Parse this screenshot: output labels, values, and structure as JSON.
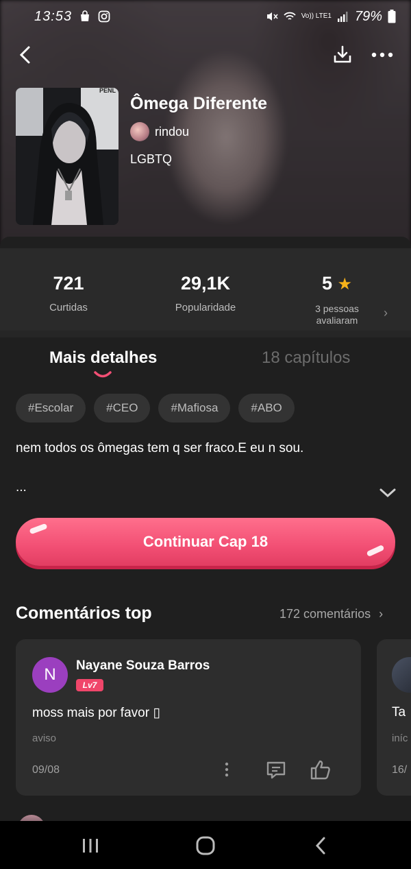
{
  "status_bar": {
    "time": "13:53",
    "battery": "79%",
    "network": "Vo)) LTE1"
  },
  "book": {
    "title": "Ômega Diferente",
    "author": "rindou",
    "genre": "LGBTQ",
    "cover_text": "PENL"
  },
  "stats": {
    "likes_value": "721",
    "likes_label": "Curtidas",
    "popularity_value": "29,1K",
    "popularity_label": "Popularidade",
    "rating_value": "5",
    "rating_label_line1": "3 pessoas",
    "rating_label_line2": "avaliaram"
  },
  "tabs": {
    "details": "Mais detalhes",
    "chapters": "18 capítulos"
  },
  "tags": [
    "#Escolar",
    "#CEO",
    "#Mafiosa",
    "#ABO"
  ],
  "description": "nem todos os ômegas tem q ser fraco.E eu n sou.",
  "ellipsis": "...",
  "continue_button": "Continuar Cap 18",
  "comments": {
    "section_title": "Comentários top",
    "count_label": "172 comentários",
    "items": [
      {
        "avatar_letter": "N",
        "name": "Nayane Souza Barros",
        "level": "Lv7",
        "text": "moss mais por favor ▯",
        "tag": "aviso",
        "date": "09/08"
      },
      {
        "text": "Ta",
        "tag": "iníc",
        "date": "16/"
      }
    ]
  },
  "colors": {
    "accent": "#f24f74",
    "background": "#1f1f1f",
    "card": "#2d2d2d",
    "star": "#f6b21a"
  }
}
